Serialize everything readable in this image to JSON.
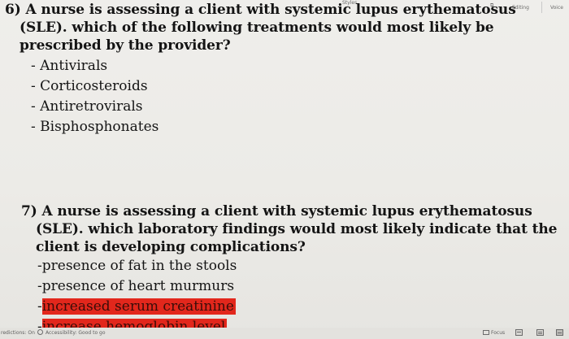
{
  "ribbon": {
    "styles_label": "Styles",
    "launcher_glyph": "⧉",
    "editing_label": "Editing",
    "voice_label": "Voice"
  },
  "question6": {
    "stem_lines": [
      "6) A nurse is assessing a client with systemic lupus erythematosus",
      "(SLE). which of the following treatments would most likely be",
      "prescribed by the provider?"
    ],
    "options": [
      "- Antivirals",
      "- Corticosteroids",
      "- Antiretrovirals",
      "- Bisphosphonates"
    ]
  },
  "question7": {
    "stem_lines": [
      "7) A nurse is assessing a client with systemic lupus erythematosus",
      "(SLE).  which laboratory findings would most likely indicate that the",
      "client is developing complications?"
    ],
    "options": [
      "-presence of fat in the stools",
      "-presence of heart murmurs"
    ],
    "highlighted_options": [
      {
        "prefix": "-",
        "text": "increased serum creatinine"
      },
      {
        "prefix": "-",
        "text": "increase hemoglobin level"
      }
    ],
    "highlight_color": "#e2271c"
  },
  "status_bar": {
    "predictions": "redictions: On",
    "accessibility": "Accessibility: Good to go",
    "focus": "Focus"
  }
}
